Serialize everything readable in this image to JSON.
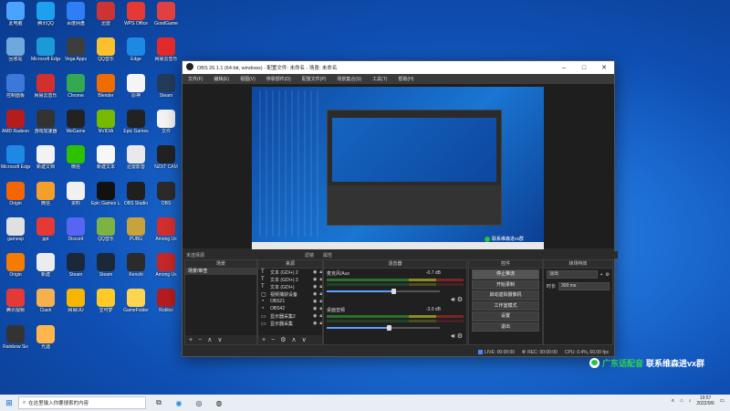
{
  "desktop": {
    "icons": [
      {
        "label": "此电脑",
        "color": "#4aa3ff"
      },
      {
        "label": "腾讯QQ",
        "color": "#1ea0f0"
      },
      {
        "label": "百度网盘",
        "color": "#2f7ef5"
      },
      {
        "label": "迅雷",
        "color": "#cc3333"
      },
      {
        "label": "WPS Office",
        "color": "#e53935"
      },
      {
        "label": "GoodGame",
        "color": "#e04040"
      },
      {
        "label": "回收站",
        "color": "#6fa8dc"
      },
      {
        "label": "Microsoft Edge",
        "color": "#1a9bd7"
      },
      {
        "label": "Vega Apps",
        "color": "#3d3d3d"
      },
      {
        "label": "QQ音乐",
        "color": "#fbc02d"
      },
      {
        "label": "Edge",
        "color": "#1e88e5"
      },
      {
        "label": "网易云音乐",
        "color": "#e32a2a"
      },
      {
        "label": "控制面板",
        "color": "#3c78d8"
      },
      {
        "label": "网易云音乐",
        "color": "#d32f2f"
      },
      {
        "label": "Chrome",
        "color": "#34a853"
      },
      {
        "label": "Blender",
        "color": "#ef6c00"
      },
      {
        "label": "原神",
        "color": "#f5f5f5"
      },
      {
        "label": "Steam",
        "color": "#233c5a"
      },
      {
        "label": "AMD Radeon",
        "color": "#b71c1c"
      },
      {
        "label": "游戏加速器",
        "color": "#333333"
      },
      {
        "label": "WeGame",
        "color": "#222222"
      },
      {
        "label": "NVIDIA",
        "color": "#76b900"
      },
      {
        "label": "Epic Games",
        "color": "#222222"
      },
      {
        "label": "文件",
        "color": "#f4f4f4"
      },
      {
        "label": "Microsoft Edge",
        "color": "#1e88e5"
      },
      {
        "label": "新建文档",
        "color": "#f2f2f2"
      },
      {
        "label": "微信",
        "color": "#2dc100"
      },
      {
        "label": "新建文本",
        "color": "#f7f7f7"
      },
      {
        "label": "迅雷影音",
        "color": "#e9e9e9"
      },
      {
        "label": "NZXT CAM",
        "color": "#222222"
      },
      {
        "label": "Origin",
        "color": "#f56600"
      },
      {
        "label": "微信",
        "color": "#f3a02b"
      },
      {
        "label": "资料",
        "color": "#f0f0f0"
      },
      {
        "label": "Epic Games Launcher",
        "color": "#111111"
      },
      {
        "label": "OBS Studio",
        "color": "#1f1f1f"
      },
      {
        "label": "OBS",
        "color": "#2b2b2b"
      },
      {
        "label": "gamexp",
        "color": "#e0e0e0"
      },
      {
        "label": "ppt",
        "color": "#e53935"
      },
      {
        "label": "Discord",
        "color": "#5865f2"
      },
      {
        "label": "QQ音乐",
        "color": "#7cb342"
      },
      {
        "label": "PUBG",
        "color": "#c8a23b"
      },
      {
        "label": "Among Us",
        "color": "#d32f2f"
      },
      {
        "label": "Origin",
        "color": "#f57c00"
      },
      {
        "label": "新建",
        "color": "#ececec"
      },
      {
        "label": "Steam",
        "color": "#1b2838"
      },
      {
        "label": "Steam",
        "color": "#1b2838"
      },
      {
        "label": "Kenshi",
        "color": "#2b2b2b"
      },
      {
        "label": "Among Us",
        "color": "#c62828"
      },
      {
        "label": "腾讯视频",
        "color": "#e53935"
      },
      {
        "label": "Clash",
        "color": "#f5b14c"
      },
      {
        "label": "网易UU",
        "color": "#f7b500"
      },
      {
        "label": "宝可梦",
        "color": "#ffca28"
      },
      {
        "label": "GameFolder",
        "color": "#ffd54f"
      },
      {
        "label": "Roblox",
        "color": "#b71c1c"
      },
      {
        "label": "Rainbow Six",
        "color": "#333333"
      },
      {
        "label": "光遇",
        "color": "#ffb74d"
      }
    ]
  },
  "obs": {
    "title": "OBS 26.1.1 (64-bit, windows) - 配置文件: 未命名 - 场景: 未命名",
    "menu": [
      "文件(F)",
      "编辑(E)",
      "视图(V)",
      "停靠部件(D)",
      "配置文件(P)",
      "场景集合(S)",
      "工具(T)",
      "帮助(H)"
    ],
    "preview_watermark": "联系维森进vx群",
    "tabs": [
      "未选择源",
      "滤镜",
      "属性"
    ],
    "scenes": {
      "header": "场景",
      "items": [
        "场景/审查"
      ]
    },
    "sources": {
      "header": "来源",
      "items": [
        {
          "icon": "T",
          "name": "文本 (GDI+) 2"
        },
        {
          "icon": "T",
          "name": "文本 (GDI+) 3"
        },
        {
          "icon": "T",
          "name": "文本 (GDI+)"
        },
        {
          "icon": "▢",
          "name": "视频捕获设备"
        },
        {
          "icon": "◔",
          "name": "OBS21"
        },
        {
          "icon": "◔",
          "name": "OBS42"
        },
        {
          "icon": "▭",
          "name": "显示器采集2"
        },
        {
          "icon": "▭",
          "name": "显示器采集"
        }
      ]
    },
    "mixer": {
      "header": "混音器",
      "channels": [
        {
          "name": "麦克风/Aux",
          "db": "-0.7 dB",
          "level": 0.62
        },
        {
          "name": "桌面音频",
          "db": "-3.0 dB",
          "level": 0.58
        }
      ]
    },
    "controls": {
      "header": "控件",
      "buttons": [
        "停止推流",
        "开始录制",
        "启动虚拟摄像机",
        "工作室模式",
        "设置",
        "退出"
      ]
    },
    "transitions": {
      "header": "转场特效",
      "selected": "淡出",
      "duration_label": "时长",
      "duration_value": "300 ms"
    },
    "status": {
      "live_label": "LIVE:",
      "live_time": "00:00:00",
      "rec_label": "REC:",
      "rec_time": "00:00:00",
      "cpu": "CPU: 0.4%, 60.00 fps"
    }
  },
  "watermark": {
    "a": "广东话配音",
    "b": "联系维森进vx群"
  },
  "taskbar": {
    "search_placeholder": "在这里输入你要搜索的内容",
    "time": "19:57",
    "date": "2022/9/6"
  }
}
